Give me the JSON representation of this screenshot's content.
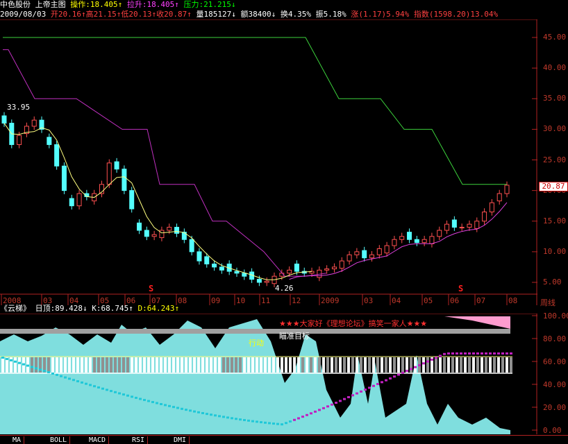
{
  "header": {
    "stock_name": "中色股份",
    "chart_name": "上帝主图",
    "op_label": "操作:",
    "op_value": "18.405↑",
    "pull_label": "拉升:",
    "pull_value": "18.405↑",
    "press_label": "压力:",
    "press_value": "21.215↓"
  },
  "dateline": {
    "date": "2009/08/03",
    "open": "开20.16↑",
    "high": "高21.15↑",
    "low": "低20.13↑",
    "close": "收20.87↑",
    "volume": "量185127↓",
    "amount": "额38400↓",
    "turnover": "换4.35%",
    "amplitude": "振5.18%",
    "change": "涨(1.17)5.94%",
    "index": "指数(1598.20)13.04%"
  },
  "price_axis": [
    "45.00",
    "40.00",
    "35.00",
    "30.00",
    "25.00",
    "20.00",
    "15.00",
    "10.00",
    "5.00"
  ],
  "price_tag": "20.87",
  "annotations": {
    "high": "33.95",
    "low": "4.26",
    "s1": "S",
    "s2": "S"
  },
  "time_axis": [
    "2008",
    "03",
    "04",
    "05",
    "06",
    "07",
    "08",
    "09",
    "10",
    "11",
    "12",
    "2009",
    "03",
    "04",
    "05",
    "06",
    "07",
    "08"
  ],
  "period_label": "周线",
  "sub": {
    "title": "《云梯》",
    "top_label": "日顶:89.428↓",
    "k_label": "K:68.745↑",
    "d_label": "D:64.243↑",
    "banner": "★★★大家好《理想论坛》搞笑一家人★★★",
    "target": "瞄准目标",
    "action": "行动",
    "axis": [
      "100.00",
      "80.00",
      "60.00",
      "40.00",
      "20.00",
      "0.00"
    ]
  },
  "tabs": [
    "MA",
    "BOLL",
    "MACD",
    "RSI",
    "DMI"
  ],
  "chart_data": {
    "type": "line",
    "series": [],
    "candles_close": [
      31.0,
      27.5,
      29.0,
      30.5,
      31.5,
      30.0,
      27.5,
      24.0,
      20.0,
      17.5,
      19.5,
      19.0,
      19.5,
      21.0,
      24.5,
      23.5,
      20.0,
      17.0,
      13.5,
      12.5,
      12.8,
      13.5,
      14.0,
      13.0,
      12.0,
      10.0,
      8.5,
      8.0,
      7.5,
      7.0,
      6.8,
      6.5,
      6.0,
      5.5,
      5.0,
      5.2,
      6.0,
      6.5,
      7.0,
      6.8,
      6.5,
      6.8,
      7.0,
      7.2,
      7.5,
      8.5,
      9.5,
      10.0,
      9.0,
      9.5,
      10.5,
      11.0,
      12.0,
      12.5,
      12.0,
      11.5,
      12.0,
      12.5,
      13.5,
      14.5,
      14.0,
      14.0,
      14.5,
      15.0,
      16.5,
      18.0,
      19.5,
      20.87
    ]
  }
}
